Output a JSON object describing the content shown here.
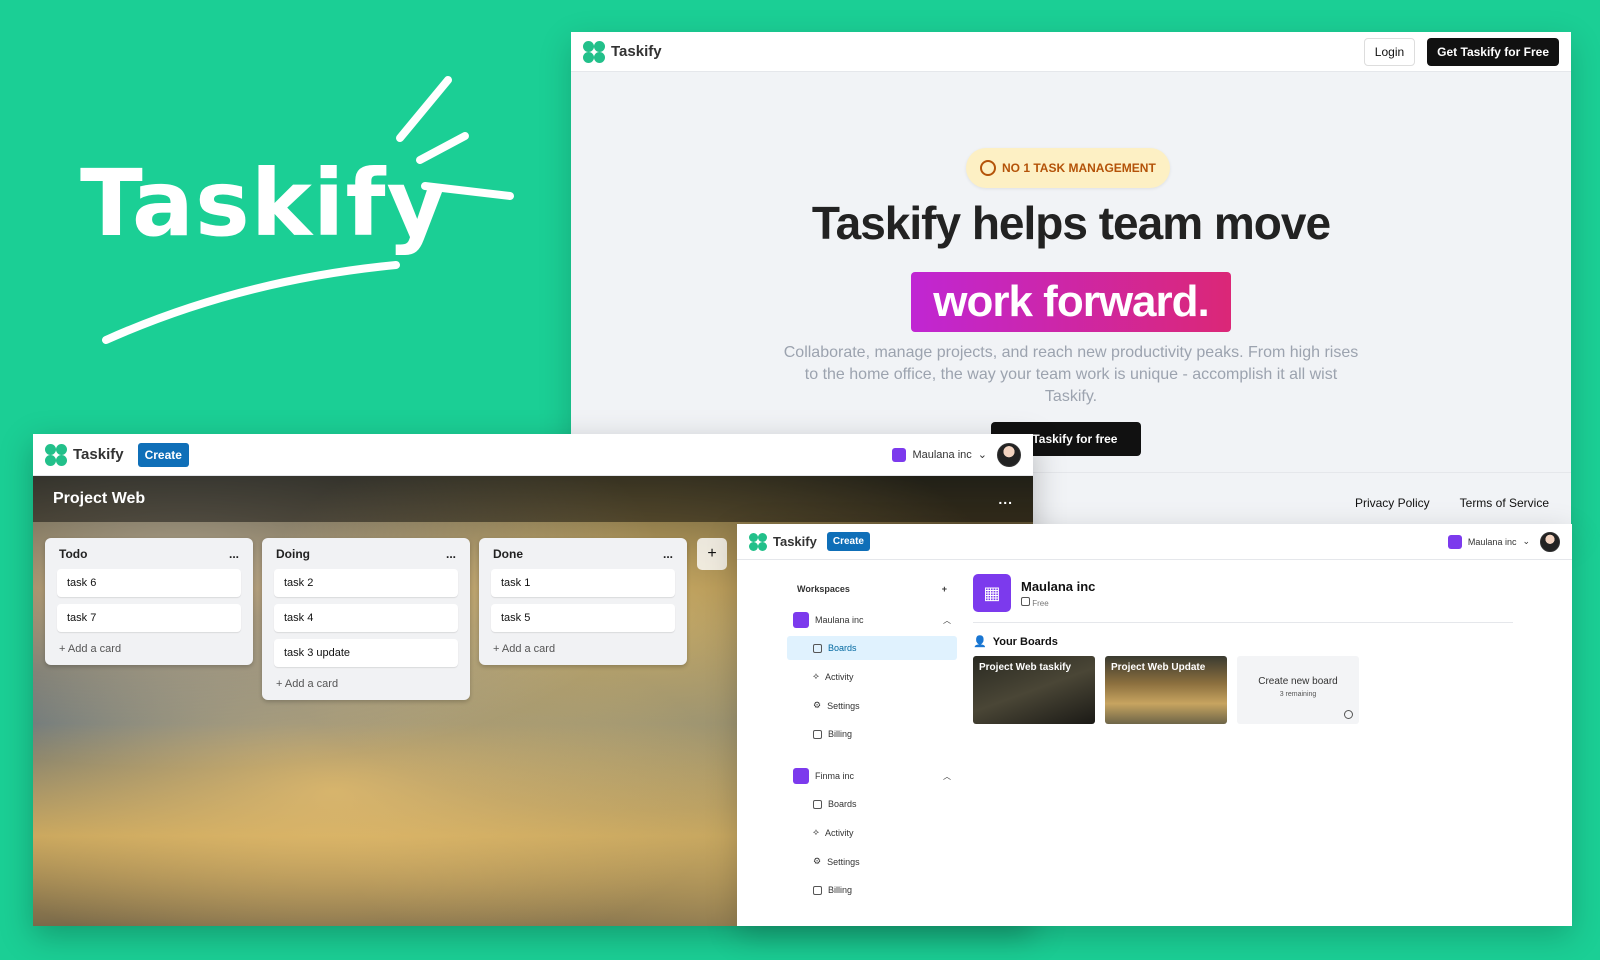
{
  "brand": {
    "title": "Taskify"
  },
  "landing": {
    "logo_text": "Taskify",
    "login": "Login",
    "cta_top": "Get Taskify for Free",
    "badge": "NO 1 TASK MANAGEMENT",
    "hero_line1": "Taskify helps team move",
    "hero_line2": "work forward.",
    "subtitle": "Collaborate, manage projects, and reach new productivity peaks. From high rises to the home office, the way your team work is unique - accomplish it all wist Taskify.",
    "cta_hero": "t Taskify for free",
    "footer": {
      "privacy": "Privacy Policy",
      "terms": "Terms of Service"
    }
  },
  "board": {
    "logo_text": "Taskify",
    "create": "Create",
    "org": "Maulana inc",
    "title": "Project Web",
    "menu": "...",
    "add_card": "Add a card",
    "lists": [
      {
        "title": "Todo",
        "cards": [
          "task 6",
          "task 7"
        ]
      },
      {
        "title": "Doing",
        "cards": [
          "task 2",
          "task 4",
          "task 3 update"
        ]
      },
      {
        "title": "Done",
        "cards": [
          "task 1",
          "task 5"
        ]
      }
    ]
  },
  "workspace": {
    "logo_text": "Taskify",
    "create": "Create",
    "org": "Maulana inc",
    "sidebar_title": "Workspaces",
    "orgs": [
      {
        "name": "Maulana inc",
        "items": [
          "Boards",
          "Activity",
          "Settings",
          "Billing"
        ]
      },
      {
        "name": "Finma inc",
        "items": [
          "Boards",
          "Activity",
          "Settings",
          "Billing"
        ]
      }
    ],
    "main": {
      "org_name": "Maulana inc",
      "plan": "Free",
      "boards_title": "Your Boards",
      "boards": [
        "Project Web taskify",
        "Project Web Update"
      ],
      "new_board": "Create new board",
      "remaining": "3 remaining"
    }
  }
}
